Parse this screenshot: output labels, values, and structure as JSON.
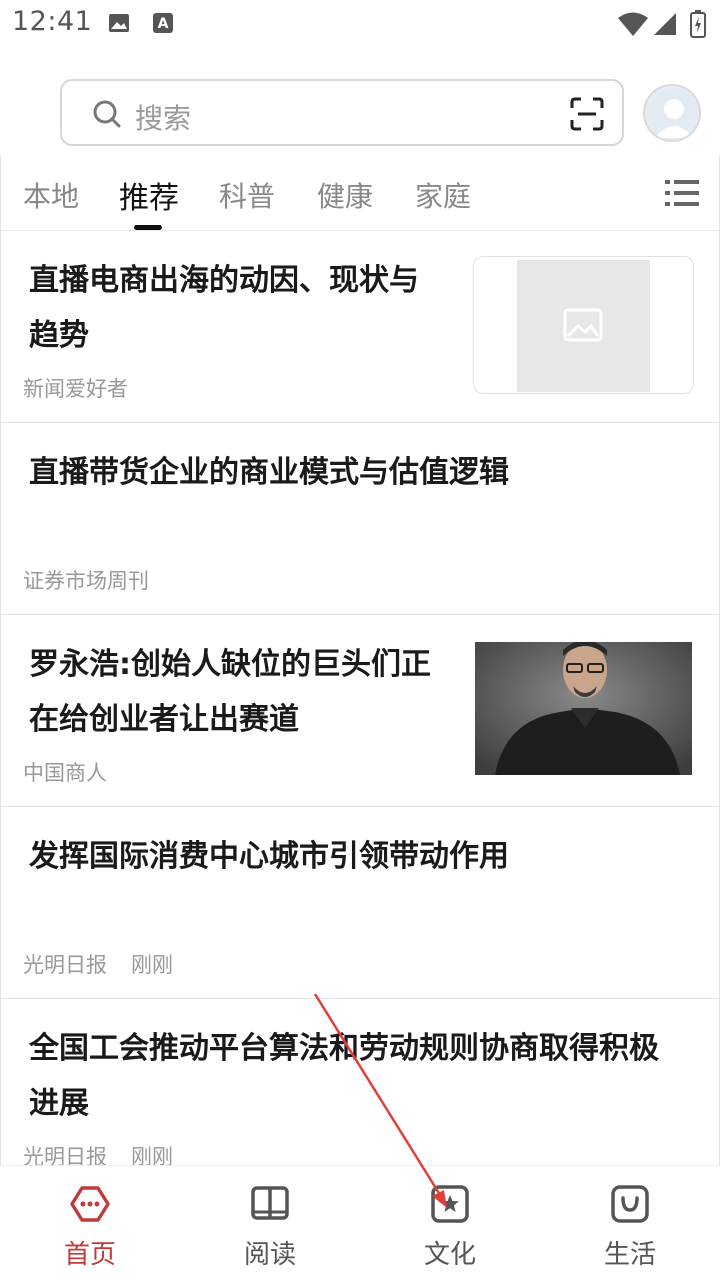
{
  "status_bar": {
    "time": "12:41"
  },
  "search": {
    "placeholder": "搜索"
  },
  "tabs": [
    {
      "label": "本地",
      "active": false
    },
    {
      "label": "推荐",
      "active": true
    },
    {
      "label": "科普",
      "active": false
    },
    {
      "label": "健康",
      "active": false
    },
    {
      "label": "家庭",
      "active": false
    }
  ],
  "articles": [
    {
      "title_line1": "直播电商出海的动因、现状与",
      "title_line2": "趋势",
      "source": "新闻爱好者",
      "time": "",
      "thumbnail": "placeholder-image"
    },
    {
      "title_line1": "直播带货企业的商业模式与估值逻辑",
      "title_line2": "",
      "source": "证券市场周刊",
      "time": "",
      "thumbnail": ""
    },
    {
      "title_line1": "罗永浩:创始人缺位的巨头们正",
      "title_line2": "在给创业者让出赛道",
      "source": "中国商人",
      "time": "",
      "thumbnail": "photo-man-black-shirt"
    },
    {
      "title_line1": "发挥国际消费中心城市引领带动作用",
      "title_line2": "",
      "source": "光明日报",
      "time": "刚刚",
      "thumbnail": ""
    },
    {
      "title_line1": "全国工会推动平台算法和劳动规则协商取得积极",
      "title_line2": "进展",
      "source": "光明日报",
      "time": "刚刚",
      "thumbnail": ""
    }
  ],
  "bottom_nav": [
    {
      "label": "首页",
      "icon": "home-hexagon-icon",
      "active": true
    },
    {
      "label": "阅读",
      "icon": "book-icon",
      "active": false
    },
    {
      "label": "文化",
      "icon": "star-square-icon",
      "active": false
    },
    {
      "label": "生活",
      "icon": "bag-icon",
      "active": false
    }
  ],
  "colors": {
    "accent": "#c23b3b",
    "annotation_arrow": "#e0403c"
  }
}
